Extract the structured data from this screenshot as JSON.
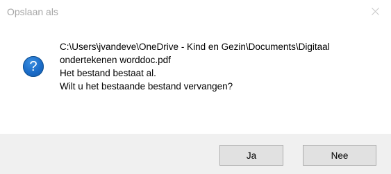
{
  "window": {
    "title": "Opslaan als",
    "close_icon": "close-icon"
  },
  "message": {
    "icon": "question-icon",
    "icon_glyph": "?",
    "path_line1": "C:\\Users\\jvandeve\\OneDrive - Kind en Gezin\\Documents\\Digitaal",
    "path_line2": "ondertekenen worddoc.pdf",
    "line3": "Het bestand bestaat al.",
    "line4": "Wilt u het bestaande bestand vervangen?"
  },
  "buttons": {
    "yes_label": "Ja",
    "no_label": "Nee"
  },
  "colors": {
    "title_text": "#a6a6a6",
    "footer_bg": "#f0f0f0",
    "button_bg": "#e1e1e1",
    "icon_blue": "#1a6bc7"
  }
}
